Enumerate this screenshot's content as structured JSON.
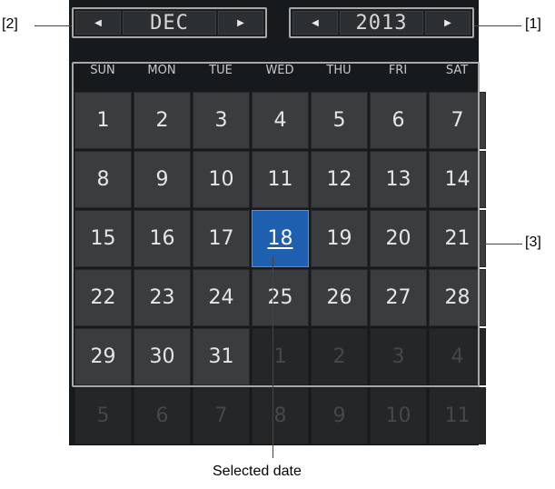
{
  "month_nav": {
    "prev_icon": "triangle-left-icon",
    "value": "DEC",
    "next_icon": "triangle-right-icon"
  },
  "year_nav": {
    "prev_icon": "triangle-left-icon",
    "value": "2013",
    "next_icon": "triangle-right-icon"
  },
  "weekdays": [
    "SUN",
    "MON",
    "TUE",
    "WED",
    "THU",
    "FRI",
    "SAT"
  ],
  "days": [
    [
      "1",
      "2",
      "3",
      "4",
      "5",
      "6",
      "7"
    ],
    [
      "8",
      "9",
      "10",
      "11",
      "12",
      "13",
      "14"
    ],
    [
      "15",
      "16",
      "17",
      "18",
      "19",
      "20",
      "21"
    ],
    [
      "22",
      "23",
      "24",
      "25",
      "26",
      "27",
      "28"
    ],
    [
      "29",
      "30",
      "31",
      "1",
      "2",
      "3",
      "4"
    ],
    [
      "5",
      "6",
      "7",
      "8",
      "9",
      "10",
      "11"
    ]
  ],
  "selected_day": "18",
  "callouts": {
    "label_2": "[2]",
    "label_1": "[1]",
    "label_3": "[3]",
    "selected": "Selected date"
  },
  "colors": {
    "panel": "#171a1c",
    "cell": "#3a3c3e",
    "selected": "#1f5fb0",
    "frame": "#a8a8a8"
  }
}
